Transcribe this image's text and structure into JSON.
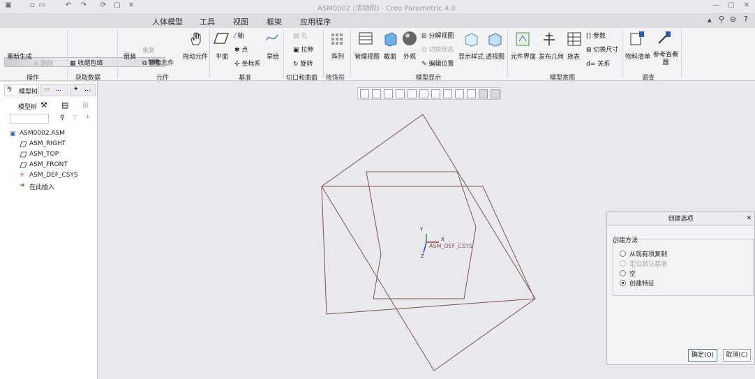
{
  "window": {
    "title": "ASM0002 (活动的) - Creo Parametric 4.0"
  },
  "tabs": [
    {
      "label": "人体模型"
    },
    {
      "label": "工具"
    },
    {
      "label": "视图"
    },
    {
      "label": "框架"
    },
    {
      "label": "应用程序"
    }
  ],
  "ribbon": {
    "create_small": "创建",
    "regen": "重新生成",
    "delete_small": "删除",
    "shrinkwrap": "收缩包络",
    "assemble": "组装",
    "repeat": "重复",
    "mirror_comp": "镜像元件",
    "drag_comp": "拖动元件",
    "plane": "平面",
    "axis": "轴",
    "point": "点",
    "coord_sys": "坐标系",
    "sketch": "草绘",
    "hole": "孔",
    "extrude": "拉伸",
    "revolve": "旋转",
    "pattern": "阵列",
    "manage_views": "管理视图",
    "section": "截面",
    "appearance": "外观",
    "exploded_view": "分解视图",
    "toggle_status": "切换状态",
    "edit_position": "编辑位置",
    "display_style": "显示样式",
    "perspective": "透视图",
    "comp_interface": "元件界面",
    "publish_geom": "发布几何",
    "family_table": "族表",
    "params": "参数",
    "switch_dims": "切换尺寸",
    "relations": "关系",
    "bom": "物料清单",
    "ref_viewer": "参考查看器",
    "groups": {
      "operations": "操作",
      "get_data": "获取数据",
      "component": "元件",
      "datum": "基准",
      "cut_surface": "切口和曲面",
      "modifiers": "修饰符",
      "model_display": "模型显示",
      "model_intent": "模型意图",
      "investigate": "调查"
    }
  },
  "left_panel": {
    "tab_model_tree": "模型树",
    "toolbar_label": "模型树",
    "tree": [
      {
        "label": "ASM0002.ASM"
      },
      {
        "label": "ASM_RIGHT"
      },
      {
        "label": "ASM_TOP"
      },
      {
        "label": "ASM_FRONT"
      },
      {
        "label": "ASM_DEF_CSYS"
      },
      {
        "label": "在此插入"
      }
    ]
  },
  "graphics": {
    "csys_label": "ASM_DEF_CSYS",
    "axis_x": "X",
    "axis_y": "Y",
    "axis_z": "Z"
  },
  "dialog": {
    "title": "创建选项",
    "group_label": "创建方法",
    "options": [
      {
        "label": "从现有项复制",
        "checked": false,
        "disabled": false
      },
      {
        "label": "定位默认基准",
        "checked": false,
        "disabled": true
      },
      {
        "label": "空",
        "checked": false,
        "disabled": false
      },
      {
        "label": "创建特征",
        "checked": true,
        "disabled": false
      }
    ],
    "ok": "确定(O)",
    "cancel": "取消(C)"
  },
  "colors": {
    "accent": "#7a5cff",
    "datum_line": "#7a5555"
  }
}
